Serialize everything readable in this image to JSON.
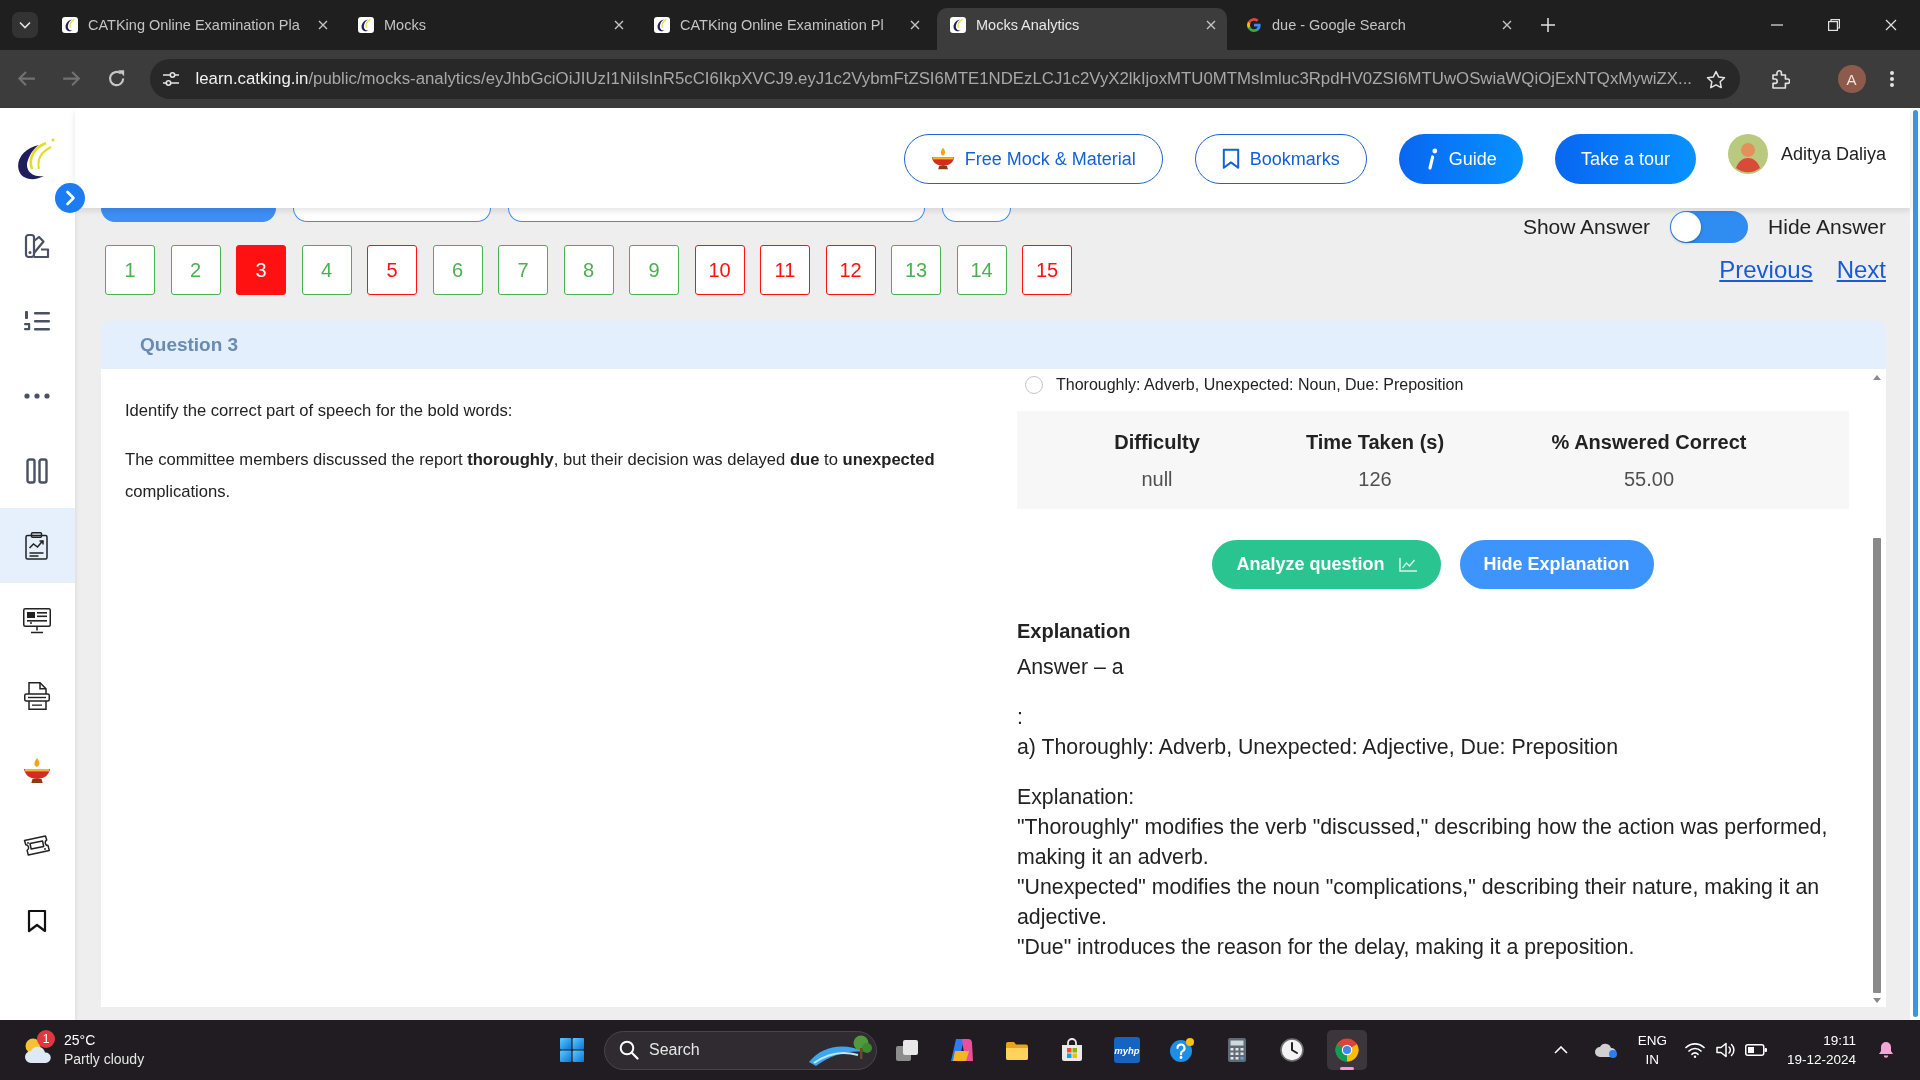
{
  "browser": {
    "tabs": [
      {
        "title": "CATKing Online Examination Pla",
        "kind": "site",
        "selected": false
      },
      {
        "title": "Mocks",
        "kind": "site",
        "selected": false
      },
      {
        "title": "CATKing Online Examination Pl",
        "kind": "site",
        "selected": false
      },
      {
        "title": "Mocks Analytics",
        "kind": "site",
        "selected": true
      },
      {
        "title": "due - Google Search",
        "kind": "search",
        "selected": false
      }
    ],
    "back": {
      "disabled": true
    },
    "forward": {
      "disabled": true
    },
    "url_host": "learn.catking.in",
    "url_path": "/public/mocks-analytics/eyJhbGciOiJIUzI1NiIsInR5cCI6IkpXVCJ9.eyJ1c2VybmFtZSI6MTE1NDEzLCJ1c2VyX2lkIjoxMTU0MTMsImluc3RpdHV0ZSI6MTUwOSwiaWQiOjExNTQxMywiZX...",
    "profile_initial": "A"
  },
  "sidebar": {
    "items": [
      {
        "selected": false
      },
      {
        "selected": false
      },
      {
        "selected": false
      },
      {
        "selected": false
      },
      {
        "selected": true
      },
      {
        "selected": false
      },
      {
        "selected": false
      },
      {
        "selected": false
      },
      {
        "selected": false
      },
      {
        "selected": false
      }
    ]
  },
  "header": {
    "buttons": [
      {
        "label": "Free Mock & Material",
        "kind": "outline"
      },
      {
        "label": "Bookmarks",
        "kind": "outline"
      },
      {
        "label": "Guide",
        "kind": "filled"
      },
      {
        "label": "Take a tour",
        "kind": "filled"
      }
    ],
    "user_name": "Aditya Daliya"
  },
  "section_tabs": [
    {
      "selected": true
    },
    {
      "selected": false
    },
    {
      "selected": false
    },
    {
      "selected": false
    }
  ],
  "answer_toggle": {
    "left_label": "Show Answer",
    "right_label": "Hide Answer",
    "on": false
  },
  "question_nav": {
    "questions": [
      {
        "number": "1",
        "color": "#4caf50",
        "selected": false
      },
      {
        "number": "2",
        "color": "#4caf50",
        "selected": false
      },
      {
        "number": "3",
        "color": "#ff1111",
        "selected": true
      },
      {
        "number": "4",
        "color": "#4caf50",
        "selected": false
      },
      {
        "number": "5",
        "color": "#ff1111",
        "selected": false
      },
      {
        "number": "6",
        "color": "#4caf50",
        "selected": false
      },
      {
        "number": "7",
        "color": "#4caf50",
        "selected": false
      },
      {
        "number": "8",
        "color": "#4caf50",
        "selected": false
      },
      {
        "number": "9",
        "color": "#4caf50",
        "selected": false
      },
      {
        "number": "10",
        "color": "#ff1111",
        "selected": false
      },
      {
        "number": "11",
        "color": "#ff1111",
        "selected": false
      },
      {
        "number": "12",
        "color": "#ff1111",
        "selected": false
      },
      {
        "number": "13",
        "color": "#4caf50",
        "selected": false
      },
      {
        "number": "14",
        "color": "#4caf50",
        "selected": false
      },
      {
        "number": "15",
        "color": "#ff1111",
        "selected": false
      }
    ],
    "previous": "Previous",
    "next": "Next"
  },
  "question": {
    "title": "Question 3",
    "prompt": "Identify the correct part of speech for the bold words:",
    "sentence": "The committee members discussed the report **thoroughly**, but their decision was delayed **due** to **unexpected** complications."
  },
  "answer_pane": {
    "option": {
      "text": "Thoroughly: Adverb, Unexpected: Noun, Due: Preposition",
      "selected": false
    },
    "stats": {
      "columns": [
        "Difficulty",
        "Time Taken (s)",
        "% Answered Correct"
      ],
      "values": [
        "null",
        "126",
        "55.00"
      ]
    },
    "buttons": [
      {
        "label": "Analyze question",
        "kind": "analyze"
      },
      {
        "label": "Hide Explanation",
        "kind": "toggle"
      }
    ],
    "explanation": {
      "title": "Explanation",
      "paragraphs": [
        [
          "Answer – a"
        ],
        [
          ":",
          "a) Thoroughly: Adverb, Unexpected: Adjective, Due: Preposition"
        ],
        [
          "Explanation:",
          "\"Thoroughly\" modifies the verb \"discussed,\" describing how the action was performed, making it an adverb.",
          "\"Unexpected\" modifies the noun \"complications,\" describing their nature, making it an adjective.",
          "\"Due\" introduces the reason for the delay, making it a preposition."
        ]
      ]
    }
  },
  "taskbar": {
    "weather": {
      "badge": "1",
      "temperature": "25°C",
      "condition": "Partly cloudy"
    },
    "search": {
      "placeholder": "Search"
    },
    "apps": [
      {
        "selected": false
      },
      {
        "selected": false
      },
      {
        "selected": false
      },
      {
        "selected": false
      },
      {
        "label": "myhp",
        "selected": false
      },
      {
        "selected": false
      },
      {
        "selected": false
      },
      {
        "selected": false
      },
      {
        "selected": true
      }
    ],
    "language": "ENG",
    "region": "IN",
    "time": "19:11",
    "date": "19-12-2024"
  }
}
